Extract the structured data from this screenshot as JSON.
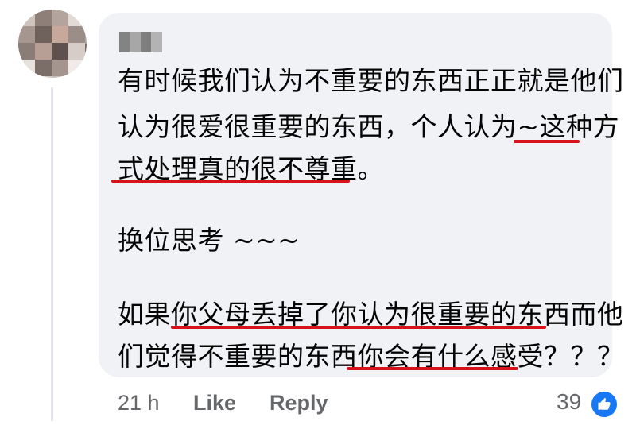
{
  "comment": {
    "lines": [
      "有时候我们认为不重要的东西正正就是他们",
      "认为很爱很重要的东西，个人认为~这种方",
      "式处理真的很不尊重。",
      "换位思考 ~~~",
      "如果你父母丢掉了你认为很重要的东西而他",
      "们觉得不重要的东西你会有什么感受？？？"
    ]
  },
  "actions": {
    "time": "21 h",
    "like": "Like",
    "reply": "Reply"
  },
  "reactions": {
    "count": "39",
    "icon": "thumbs-up-icon"
  },
  "colors": {
    "bubble": "#f0f2f5",
    "underline": "#d8111b",
    "like_blue": "#1877f2",
    "action_gray": "#65676b"
  }
}
